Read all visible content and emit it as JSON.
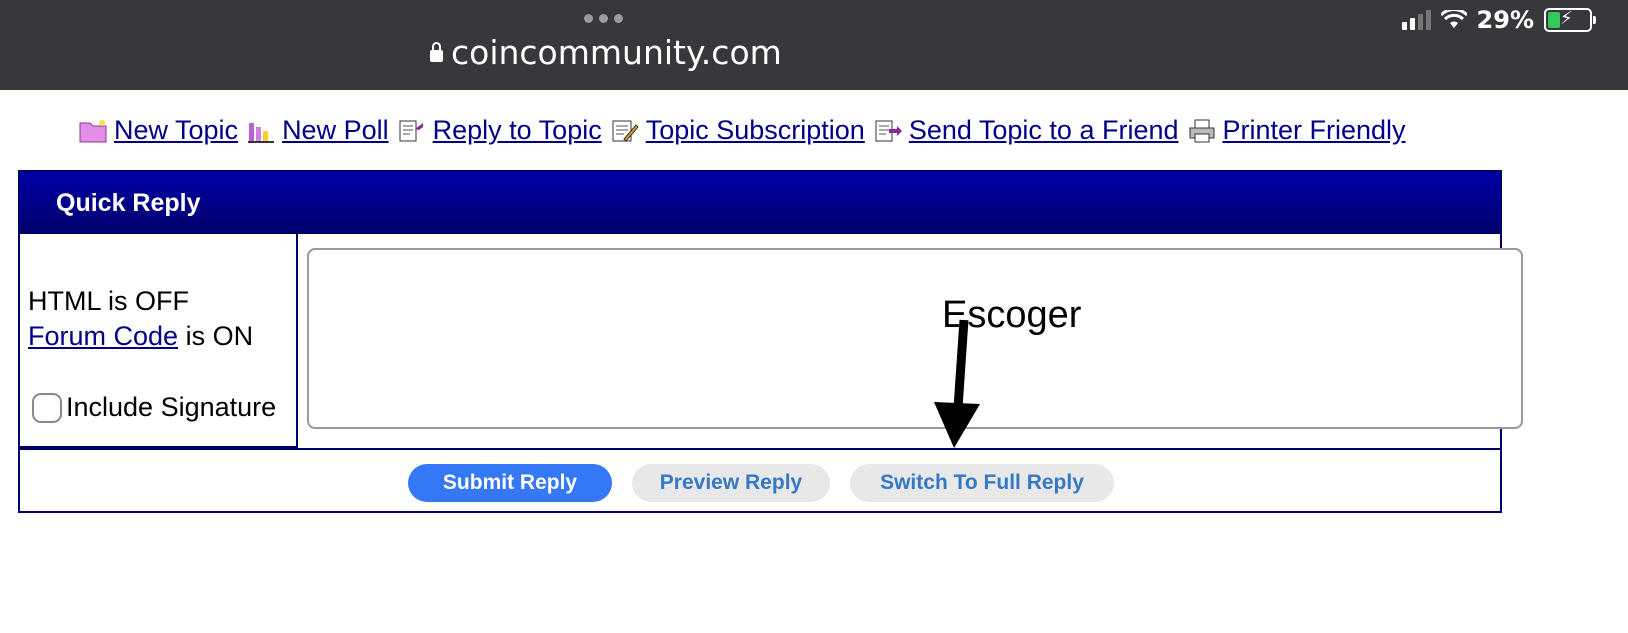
{
  "status_bar": {
    "url": "coincommunity.com",
    "battery": "29%"
  },
  "toolbar": {
    "items": [
      {
        "label": "New Topic",
        "icon": "folder-new-icon"
      },
      {
        "label": "New Poll",
        "icon": "poll-chart-icon"
      },
      {
        "label": "Reply to Topic",
        "icon": "reply-icon"
      },
      {
        "label": "Topic Subscription",
        "icon": "subscription-icon"
      },
      {
        "label": "Send Topic to a Friend",
        "icon": "send-icon"
      },
      {
        "label": "Printer Friendly",
        "icon": "printer-icon"
      }
    ]
  },
  "quick_reply": {
    "title": "Quick Reply",
    "html_status": "HTML is OFF",
    "forum_code_link": "Forum Code",
    "forum_code_status": " is ON",
    "include_signature": "Include Signature",
    "include_signature_checked": false,
    "reply_text": "",
    "buttons": {
      "submit": "Submit Reply",
      "preview": "Preview Reply",
      "switch": "Switch To Full Reply"
    }
  },
  "annotation": {
    "text": "Escoger"
  },
  "colors": {
    "header_blue": "#0000a8",
    "submit_blue": "#3478f6",
    "link_color": "#00008b"
  }
}
